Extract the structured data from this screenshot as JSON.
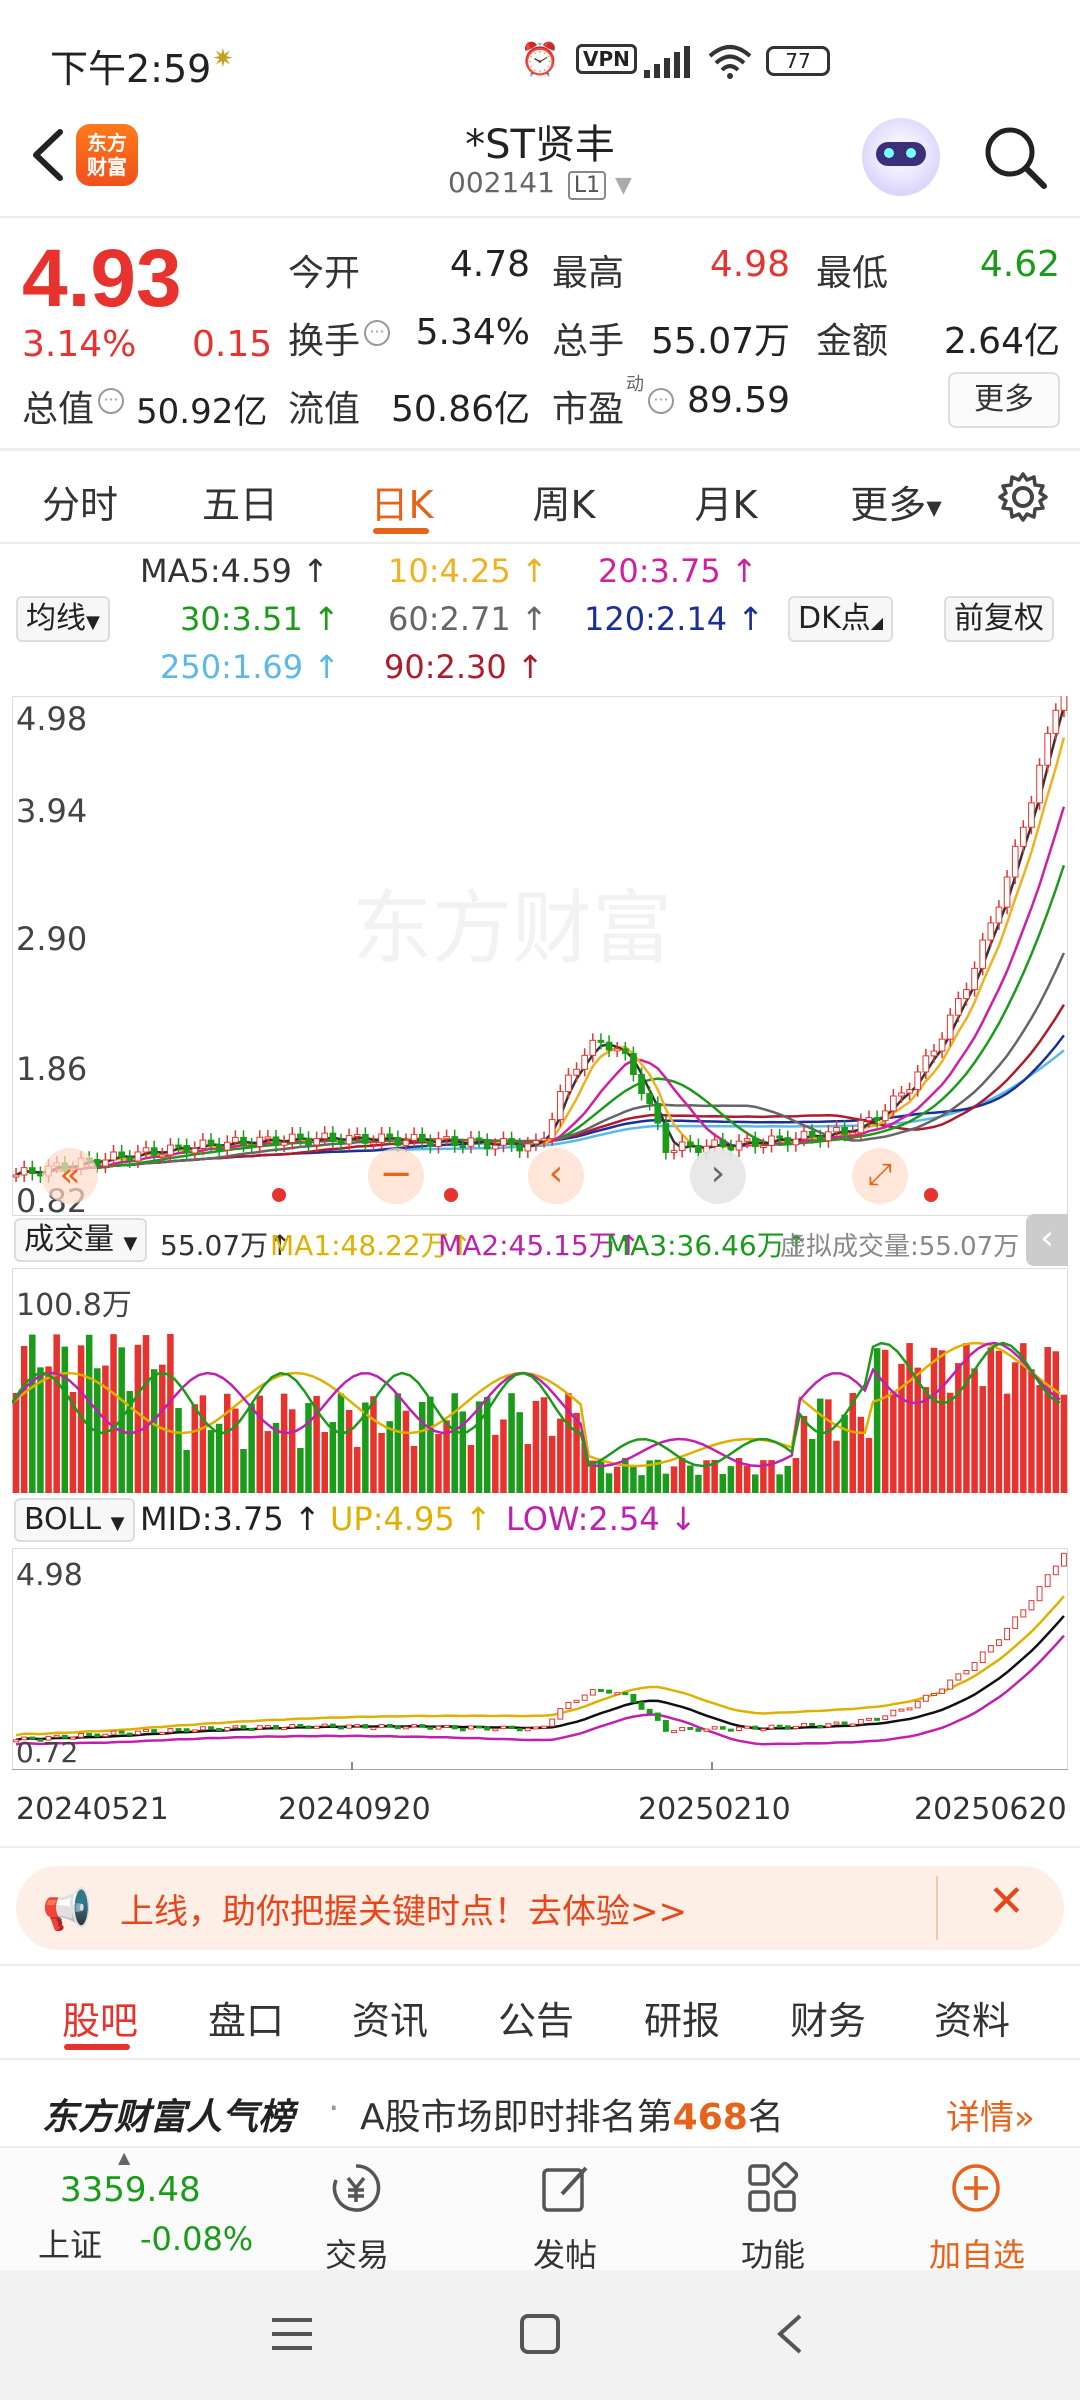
{
  "status_bar": {
    "time": "下午2:59",
    "vpn": "VPN",
    "battery": "77"
  },
  "header": {
    "back_icon": "chevron-left-icon",
    "logo": [
      "东方",
      "财富"
    ],
    "title": "*ST贤丰",
    "code": "002141",
    "level": "L1",
    "search_icon": "search-icon"
  },
  "quote": {
    "price": "4.93",
    "change_pct": "3.14%",
    "change_abs": "0.15",
    "open_label": "今开",
    "open": "4.78",
    "high_label": "最高",
    "high": "4.98",
    "low_label": "最低",
    "low": "4.62",
    "turnover_label": "换手",
    "turnover": "5.34%",
    "volume_label": "总手",
    "volume": "55.07万",
    "amount_label": "金额",
    "amount": "2.64亿",
    "mktcap_label": "总值",
    "mktcap": "50.92亿",
    "float_label": "流值",
    "float_val": "50.86亿",
    "pe_label": "市盈",
    "pe_sup": "动",
    "pe": "89.59",
    "more": "更多"
  },
  "tabs": [
    "分时",
    "五日",
    "日K",
    "周K",
    "月K",
    "更多"
  ],
  "active_tab": "日K",
  "ma_legend": {
    "selector": "均线",
    "items": [
      {
        "label": "MA5:4.59",
        "color": "#333333"
      },
      {
        "label": "10:4.25",
        "color": "#f0b020"
      },
      {
        "label": "20:3.75",
        "color": "#d020a0"
      },
      {
        "label": "30:3.51",
        "color": "#1a9b1a"
      },
      {
        "label": "60:2.71",
        "color": "#666666"
      },
      {
        "label": "120:2.14",
        "color": "#1a2f9b"
      },
      {
        "label": "250:1.69",
        "color": "#5bb8e8"
      },
      {
        "label": "90:2.30",
        "color": "#b01a2a"
      }
    ],
    "dk_button": "DK点",
    "adjust_button": "前复权"
  },
  "kline_axis": [
    "4.98",
    "3.94",
    "2.90",
    "1.86",
    "0.82"
  ],
  "watermark": "东方财富",
  "volume_legend": {
    "selector": "成交量",
    "vol": "55.07万",
    "ma1": "MA1:48.22万",
    "ma2": "MA2:45.15万",
    "ma3": "MA3:36.46万",
    "virtual": "虚拟成交量:55.07万",
    "axis_max": "100.8万"
  },
  "boll_legend": {
    "selector": "BOLL",
    "mid": "MID:3.75",
    "up": "UP:4.95",
    "low": "LOW:2.54",
    "axis_top": "4.98",
    "axis_bottom": "0.72"
  },
  "dates": [
    "20240521",
    "20240920",
    "20250210",
    "20250620"
  ],
  "banner": {
    "text": "上线，助你把握关键时点！去体验>>"
  },
  "bottom_tabs": [
    "股吧",
    "盘口",
    "资讯",
    "公告",
    "研报",
    "财务",
    "资料"
  ],
  "rank": {
    "logo": "东方财富人气榜",
    "text_prefix": "A股市场即时排名第",
    "rank": "468",
    "text_suffix": "名",
    "detail": "详情"
  },
  "toolbar": {
    "index_value": "3359.48",
    "index_name": "上证",
    "index_change": "-0.08%",
    "trade": "交易",
    "post": "发帖",
    "func": "功能",
    "watch": "加自选"
  },
  "colors": {
    "up": "#e8322e",
    "down": "#1a9b1a",
    "accent": "#e8631a"
  }
}
